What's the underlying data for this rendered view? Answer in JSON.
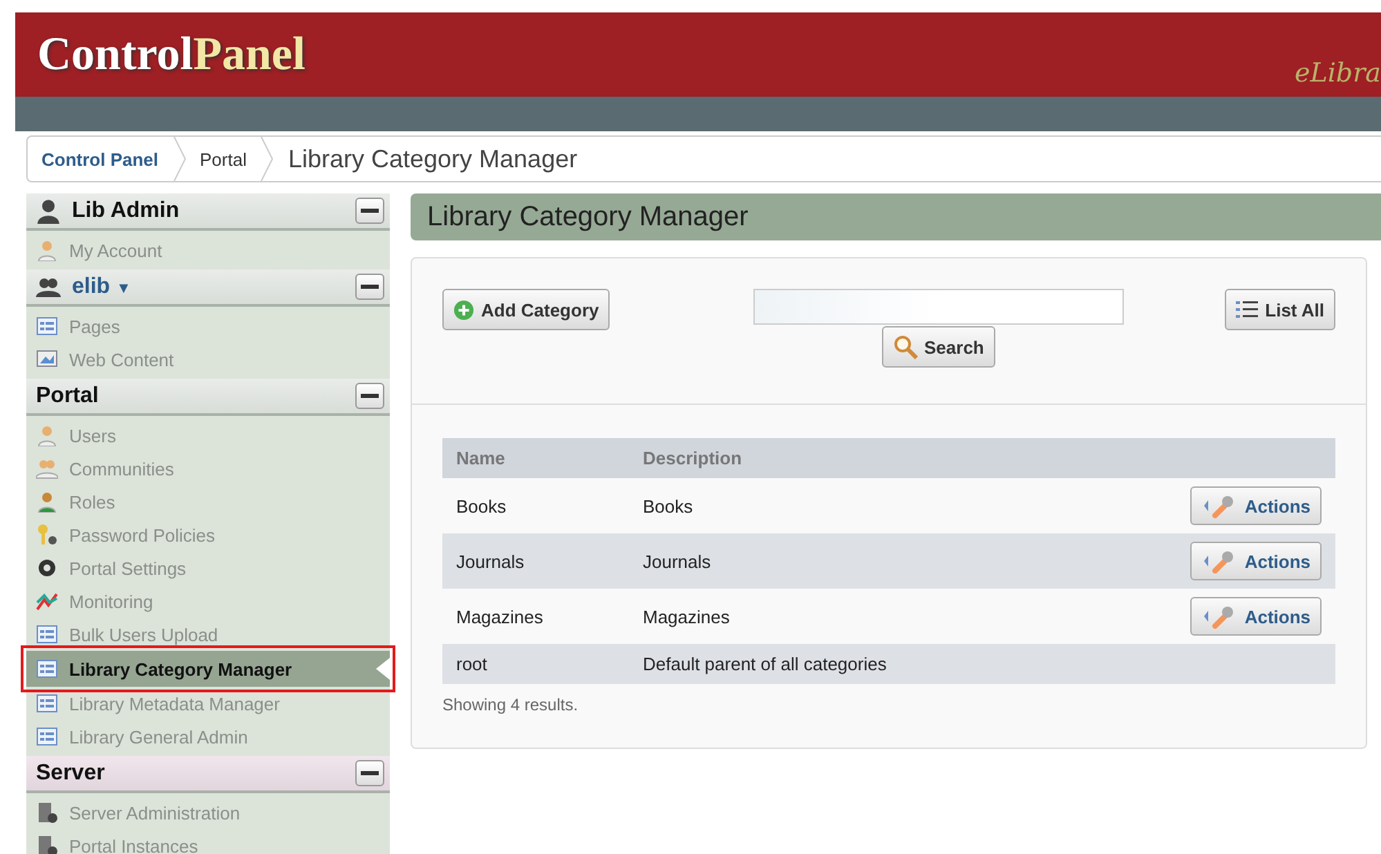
{
  "header": {
    "title_part_1": "Control",
    "title_part_2": "Panel",
    "brand": "eLibra"
  },
  "breadcrumb": [
    {
      "label": "Control Panel",
      "kind": "link"
    },
    {
      "label": "Portal",
      "kind": "link"
    },
    {
      "label": "Library Category Manager",
      "kind": "current"
    }
  ],
  "sidebar": [
    {
      "title": "Lib Admin",
      "kind": "user",
      "expanded": true,
      "items": [
        {
          "label": "My Account",
          "kind": "account",
          "selected": false
        }
      ]
    },
    {
      "title": "elib",
      "kind": "site",
      "caret": "▼",
      "expanded": true,
      "items": [
        {
          "label": "Pages",
          "kind": "page",
          "selected": false
        },
        {
          "label": "Web Content",
          "kind": "content",
          "selected": false
        }
      ]
    },
    {
      "title": "Portal",
      "kind": "plain",
      "expanded": true,
      "items": [
        {
          "label": "Users",
          "kind": "user",
          "selected": false
        },
        {
          "label": "Communities",
          "kind": "users",
          "selected": false
        },
        {
          "label": "Roles",
          "kind": "role",
          "selected": false
        },
        {
          "label": "Password Policies",
          "kind": "key",
          "selected": false
        },
        {
          "label": "Portal Settings",
          "kind": "gear",
          "selected": false
        },
        {
          "label": "Monitoring",
          "kind": "chart",
          "selected": false
        },
        {
          "label": "Bulk Users Upload",
          "kind": "form",
          "selected": false
        },
        {
          "label": "Library Category Manager",
          "kind": "form",
          "selected": true
        },
        {
          "label": "Library Metadata Manager",
          "kind": "form",
          "selected": false
        },
        {
          "label": "Library General Admin",
          "kind": "form",
          "selected": false
        }
      ]
    },
    {
      "title": "Server",
      "kind": "server",
      "expanded": true,
      "items": [
        {
          "label": "Server Administration",
          "kind": "server",
          "selected": false
        },
        {
          "label": "Portal Instances",
          "kind": "server",
          "selected": false
        }
      ]
    }
  ],
  "page_title": "Library Category Manager",
  "toolbar": {
    "add_button": "Add Category",
    "search_button": "Search",
    "list_all_button": "List All"
  },
  "table": {
    "columns": [
      "Name",
      "Description"
    ],
    "rows": [
      {
        "name": "Books",
        "description": "Books",
        "actions": "Actions"
      },
      {
        "name": "Journals",
        "description": "Journals",
        "actions": "Actions"
      },
      {
        "name": "Magazines",
        "description": "Magazines",
        "actions": "Actions"
      },
      {
        "name": "root",
        "description": "Default parent of all categories"
      }
    ]
  },
  "result_count": "Showing 4 results."
}
